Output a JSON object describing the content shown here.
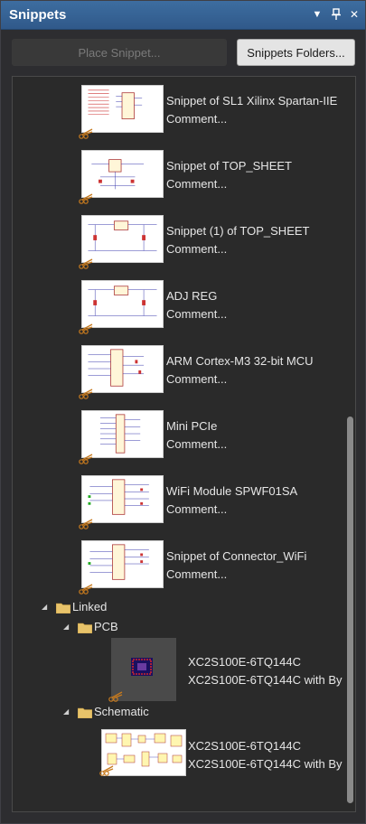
{
  "panel": {
    "title": "Snippets",
    "menu_icon": "dropdown-arrow-icon",
    "pin_icon": "pin-icon",
    "close_icon": "close-icon"
  },
  "toolbar": {
    "place_label": "Place Snippet...",
    "folders_label": "Snippets Folders..."
  },
  "snippets": [
    {
      "title": "Snippet of SL1 Xilinx Spartan-IIE",
      "comment": "Comment..."
    },
    {
      "title": "Snippet of TOP_SHEET",
      "comment": "Comment..."
    },
    {
      "title": "Snippet (1) of TOP_SHEET",
      "comment": "Comment..."
    },
    {
      "title": "ADJ REG",
      "comment": "Comment..."
    },
    {
      "title": "ARM Cortex-M3 32-bit MCU",
      "comment": "Comment..."
    },
    {
      "title": "Mini PCIe",
      "comment": "Comment..."
    },
    {
      "title": "WiFi Module SPWF01SA",
      "comment": "Comment..."
    },
    {
      "title": "Snippet of Connector_WiFi",
      "comment": "Comment..."
    }
  ],
  "linked": {
    "label": "Linked",
    "pcb": {
      "label": "PCB",
      "item": {
        "title": "XC2S100E-6TQ144C",
        "comment": "XC2S100E-6TQ144C with By"
      }
    },
    "schematic": {
      "label": "Schematic",
      "item": {
        "title": "XC2S100E-6TQ144C",
        "comment": "XC2S100E-6TQ144C with By"
      }
    }
  },
  "colors": {
    "titlebar": "#3a6898",
    "panel": "#2d2d30",
    "folder": "#e8c36a",
    "scissor": "#c77a1e"
  }
}
